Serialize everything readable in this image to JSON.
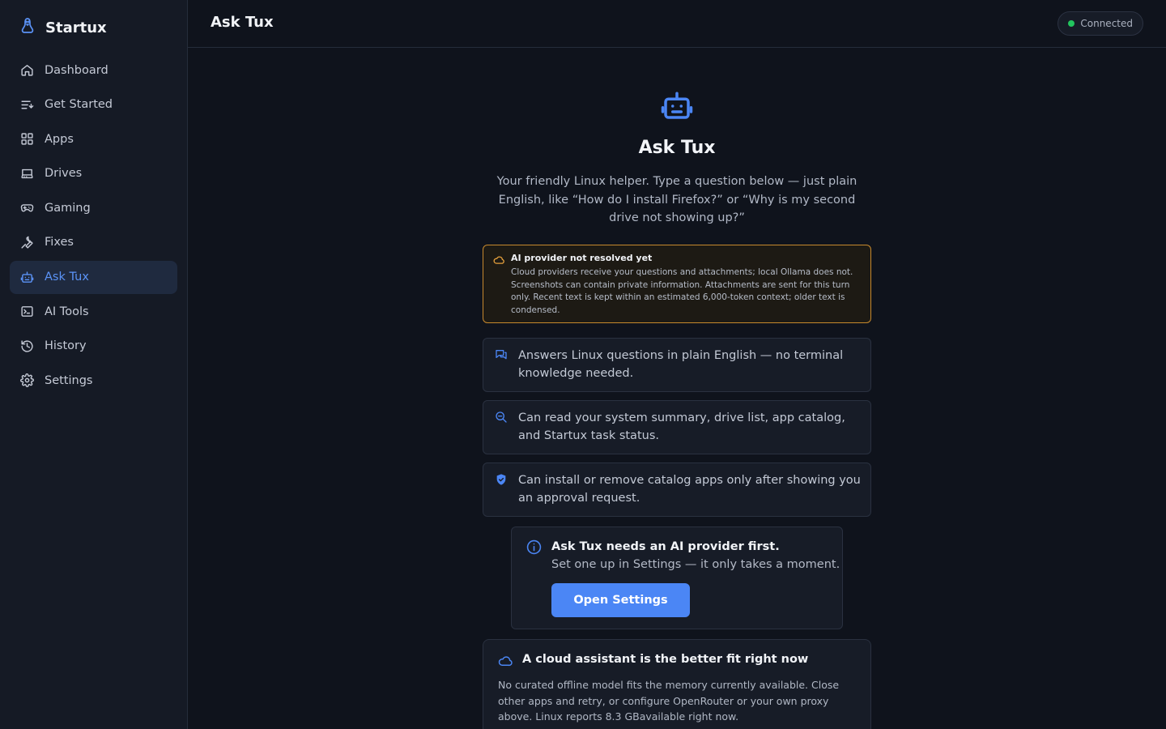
{
  "app": {
    "name": "Startux"
  },
  "sidebar": {
    "items": [
      {
        "label": "Dashboard",
        "icon": "home-icon",
        "active": false
      },
      {
        "label": "Get Started",
        "icon": "list-start-icon",
        "active": false
      },
      {
        "label": "Apps",
        "icon": "grid-icon",
        "active": false
      },
      {
        "label": "Drives",
        "icon": "hard-drive-icon",
        "active": false
      },
      {
        "label": "Gaming",
        "icon": "gamepad-icon",
        "active": false
      },
      {
        "label": "Fixes",
        "icon": "wrench-icon",
        "active": false
      },
      {
        "label": "Ask Tux",
        "icon": "robot-icon",
        "active": true
      },
      {
        "label": "AI Tools",
        "icon": "terminal-icon",
        "active": false
      },
      {
        "label": "History",
        "icon": "history-icon",
        "active": false
      },
      {
        "label": "Settings",
        "icon": "gear-icon",
        "active": false
      }
    ]
  },
  "header": {
    "title": "Ask Tux",
    "status": "Connected"
  },
  "hero": {
    "title": "Ask Tux",
    "description": "Your friendly Linux helper. Type a question below — just plain English, like “How do I install Firefox?” or “Why is my second drive not showing up?”"
  },
  "warning": {
    "title": "AI provider not resolved yet",
    "body": "Cloud providers receive your questions and attachments; local Ollama does not. Screenshots can contain private information. Attachments are sent for this turn only. Recent text is kept within an estimated 6,000-token context; older text is condensed."
  },
  "features": [
    {
      "icon": "chat-bubbles-icon",
      "text": "Answers Linux questions in plain English — no terminal knowledge needed."
    },
    {
      "icon": "search-icon",
      "text": "Can read your system summary, drive list, app catalog, and Startux task status."
    },
    {
      "icon": "shield-check-icon",
      "text": "Can install or remove catalog apps only after showing you an approval request."
    }
  ],
  "notice": {
    "title": "Ask Tux needs an AI provider first.",
    "body": "Set one up in Settings — it only takes a moment.",
    "button": "Open Settings"
  },
  "cloud": {
    "title": "A cloud assistant is the better fit right now",
    "body": "No curated offline model fits the memory currently available. Close other apps and retry, or configure OpenRouter or your own proxy above. Linux reports 8.3 GBavailable right now."
  },
  "colors": {
    "accent": "#4b86f5",
    "warning_border": "#c7892d",
    "status_ok": "#22c55e"
  }
}
